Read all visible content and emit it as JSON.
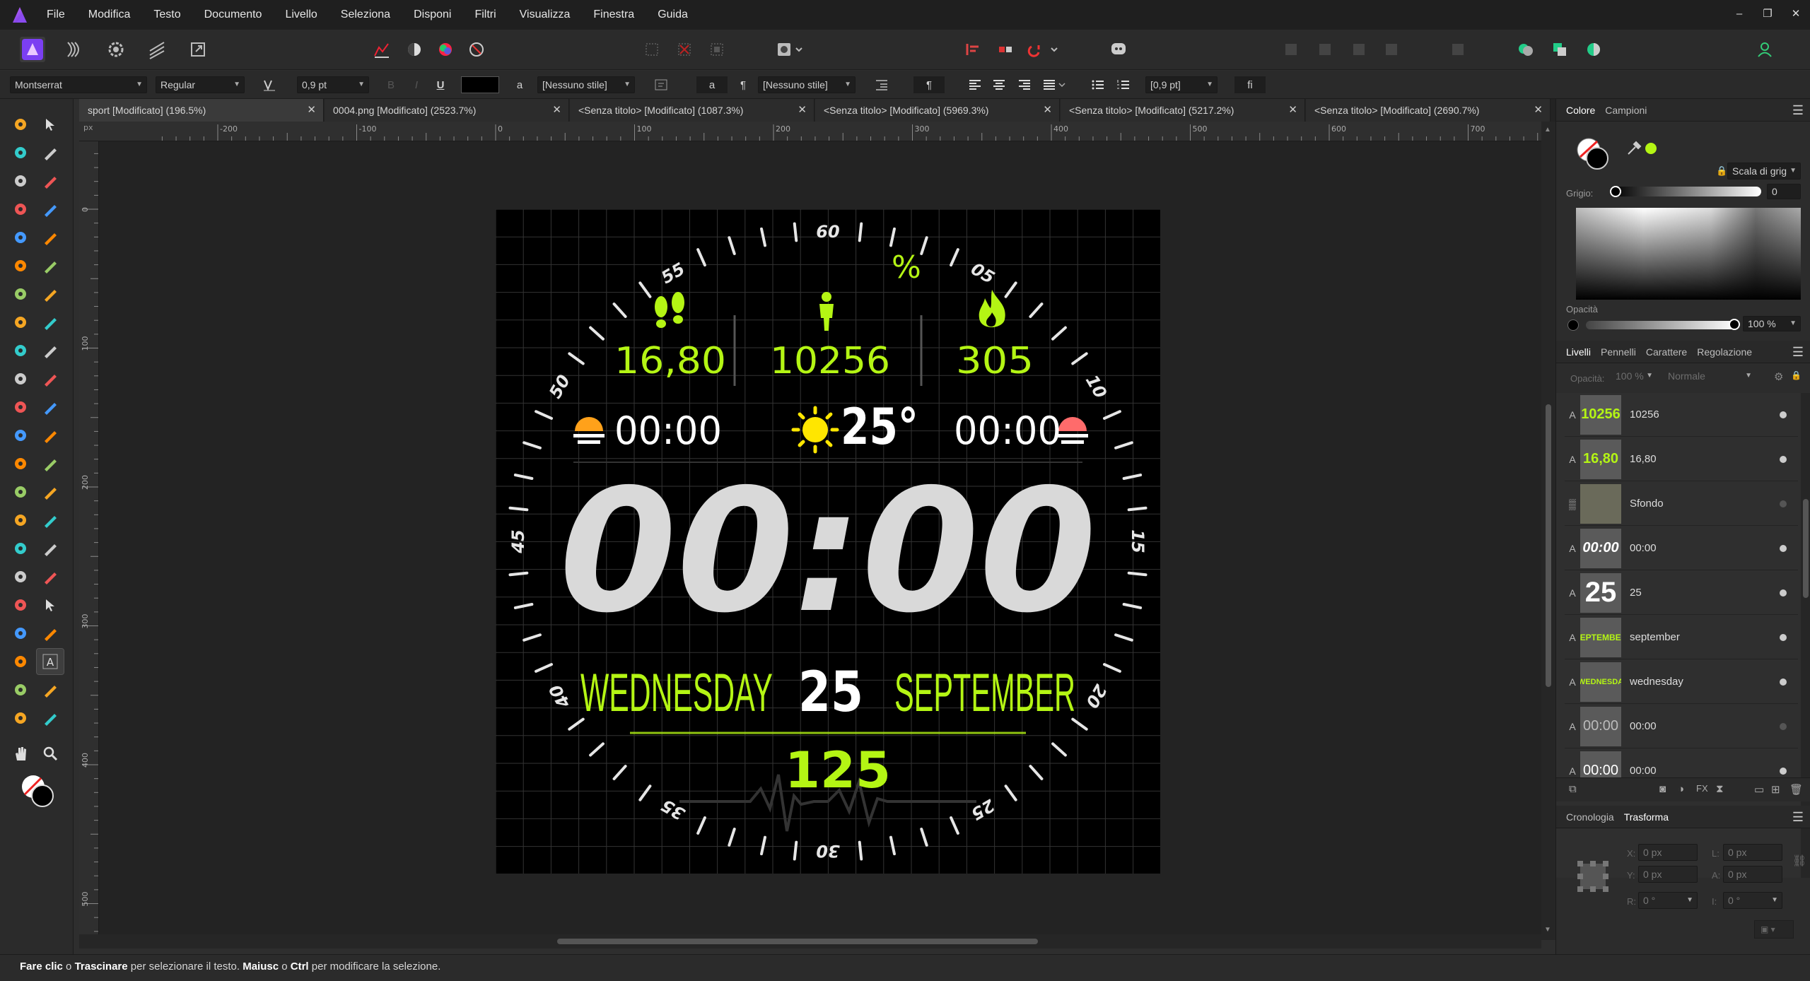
{
  "menubar": {
    "items": [
      "File",
      "Modifica",
      "Testo",
      "Documento",
      "Livello",
      "Seleziona",
      "Disponi",
      "Filtri",
      "Visualizza",
      "Finestra",
      "Guida"
    ],
    "window_controls": [
      "–",
      "❐",
      "✕"
    ]
  },
  "context": {
    "font": "Montserrat",
    "style": "Regular",
    "size": "0,9 pt",
    "char_style": "[Nessuno stile]",
    "para_style": "[Nessuno stile]",
    "leading": "[0,9 pt]",
    "bold": "B",
    "italic": "I",
    "underline": "U",
    "char_a": "a",
    "para_mark": "¶",
    "lig": "fi"
  },
  "tabs": [
    {
      "label": "sport [Modificato] (196.5%)",
      "active": true
    },
    {
      "label": "0004.png [Modificato] (2523.7%)",
      "active": false
    },
    {
      "label": "<Senza titolo> [Modificato] (1087.3%)",
      "active": false
    },
    {
      "label": "<Senza titolo> [Modificato] (5969.3%)",
      "active": false
    },
    {
      "label": "<Senza titolo> [Modificato] (5217.2%)",
      "active": false
    },
    {
      "label": "<Senza titolo> [Modificato] (2690.7%)",
      "active": false
    }
  ],
  "ruler": {
    "unit": "px",
    "h_labels": [
      "-200",
      "-100",
      "0",
      "100",
      "200",
      "300",
      "400",
      "500",
      "600",
      "700"
    ],
    "v_labels": [
      "0",
      "100",
      "200",
      "300",
      "400",
      "500"
    ]
  },
  "watch": {
    "distance": "16,80",
    "steps": "10256",
    "calories": "305",
    "percent_symbol": "%",
    "sunrise": "00:00",
    "sunset": "00:00",
    "temperature": "25°",
    "time": "00:00",
    "weekday": "WEDNESDAY",
    "day": "25",
    "month": "SEPTEMBER",
    "heart_rate": "125",
    "dial_labels": [
      "60",
      "05",
      "10",
      "15",
      "20",
      "25",
      "30",
      "35",
      "40",
      "45",
      "50",
      "55"
    ],
    "accent_color": "#b4f514",
    "sun_color": "#ffe600"
  },
  "color_panel": {
    "tabs": [
      "Colore",
      "Campioni"
    ],
    "mode": "Scala di grig",
    "grey_label": "Grigio:",
    "grey_value": "0",
    "opacity_label": "Opacità",
    "opacity_value": "100 %"
  },
  "layers_panel": {
    "tabs": [
      "Livelli",
      "Pennelli",
      "Carattere",
      "Regolazione"
    ],
    "opacity_label": "Opacità:",
    "opacity_value": "100 %",
    "blend_mode": "Normale",
    "layers": [
      {
        "type": "A",
        "name": "10256",
        "thumb": "10256",
        "visible": true
      },
      {
        "type": "A",
        "name": "16,80",
        "thumb": "16,80",
        "visible": true
      },
      {
        "type": "▒",
        "name": "Sfondo",
        "thumb": "",
        "visible": false
      },
      {
        "type": "A",
        "name": "00:00",
        "thumb": "00:00",
        "visible": true
      },
      {
        "type": "A",
        "name": "25",
        "thumb": "25",
        "visible": true
      },
      {
        "type": "A",
        "name": "september",
        "thumb": "SEPTEMBER",
        "visible": true
      },
      {
        "type": "A",
        "name": "wednesday",
        "thumb": "WEDNESDA",
        "visible": true
      },
      {
        "type": "A",
        "name": "00:00",
        "thumb": "00:00",
        "visible": false
      },
      {
        "type": "A",
        "name": "00:00",
        "thumb": "00:00",
        "visible": true
      }
    ]
  },
  "transform_panel": {
    "tabs": [
      "Cronologia",
      "Trasforma"
    ],
    "x_label": "X:",
    "x": "0 px",
    "y_label": "Y:",
    "y": "0 px",
    "w_label": "L:",
    "w": "0 px",
    "h_label": "A:",
    "h": "0 px",
    "r_label": "R:",
    "r": "0 °",
    "s_label": "I:",
    "s": "0 °"
  },
  "status": {
    "b1": "Fare clic",
    "t1": " o ",
    "b2": "Trascinare",
    "t2": " per selezionare il testo. ",
    "b3": "Maiusc",
    "t3": " o ",
    "b4": "Ctrl",
    "t4": " per modificare la selezione."
  }
}
